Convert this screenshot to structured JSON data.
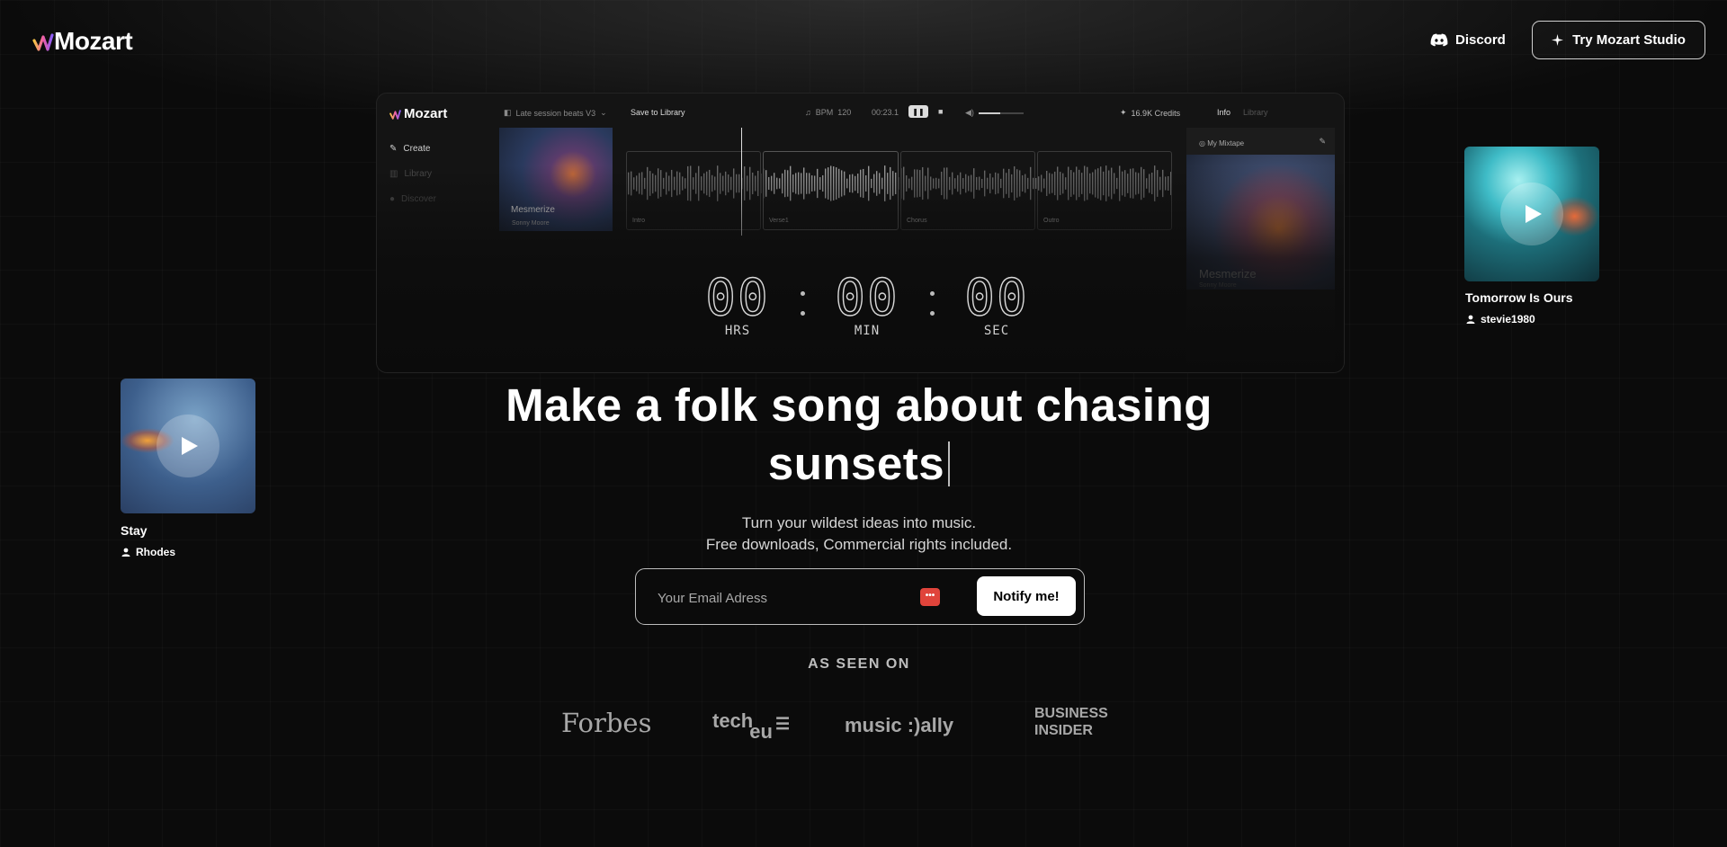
{
  "header": {
    "logo_text": "Mozart",
    "discord_label": "Discord",
    "try_label": "Try Mozart Studio"
  },
  "app_preview": {
    "logo_text": "Mozart",
    "nav": [
      "Create",
      "Library",
      "Discover"
    ],
    "project_name": "Late session beats V3",
    "save_label": "Save to Library",
    "bpm_label": "BPM",
    "bpm_value": "120",
    "time": "00:23.1",
    "credits": "16.9K Credits",
    "tabs": [
      "Info",
      "Library"
    ],
    "track_title": "Mesmerize",
    "track_artist": "Sonny Moore",
    "segments": [
      "Intro",
      "Verse1",
      "Chorus",
      "Outro"
    ],
    "panel_title": "My Mixtape",
    "panel_song": "Mesmerize",
    "panel_artist": "Sonny Moore"
  },
  "countdown": {
    "hours": "00",
    "minutes": "00",
    "seconds": "00",
    "hours_label": "HRS",
    "minutes_label": "MIN",
    "seconds_label": "SEC"
  },
  "hero": {
    "headline_line1": "Make a folk song about chasing",
    "headline_line2": "sunsets",
    "sub_line1": "Turn your wildest ideas into music.",
    "sub_line2": "Free downloads, Commercial rights included."
  },
  "signup": {
    "placeholder": "Your Email Adress",
    "button_label": "Notify me!"
  },
  "press": {
    "title": "AS SEEN ON",
    "forbes": "Forbes",
    "techeu_a": "tech",
    "techeu_b": "eu",
    "music_a": "music",
    "music_b": ":)ally",
    "bi_line1": "BUSINESS",
    "bi_line2": "INSIDER"
  },
  "cards": [
    {
      "title": "Stay",
      "artist": "Rhodes"
    },
    {
      "title": "Tomorrow Is Ours",
      "artist": "stevie1980"
    }
  ],
  "colors": {
    "background": "#0b0b0b",
    "accent_red": "#e0443b",
    "logo_gradient": [
      "#f6c445",
      "#ef5da8",
      "#8a5cf6"
    ]
  }
}
